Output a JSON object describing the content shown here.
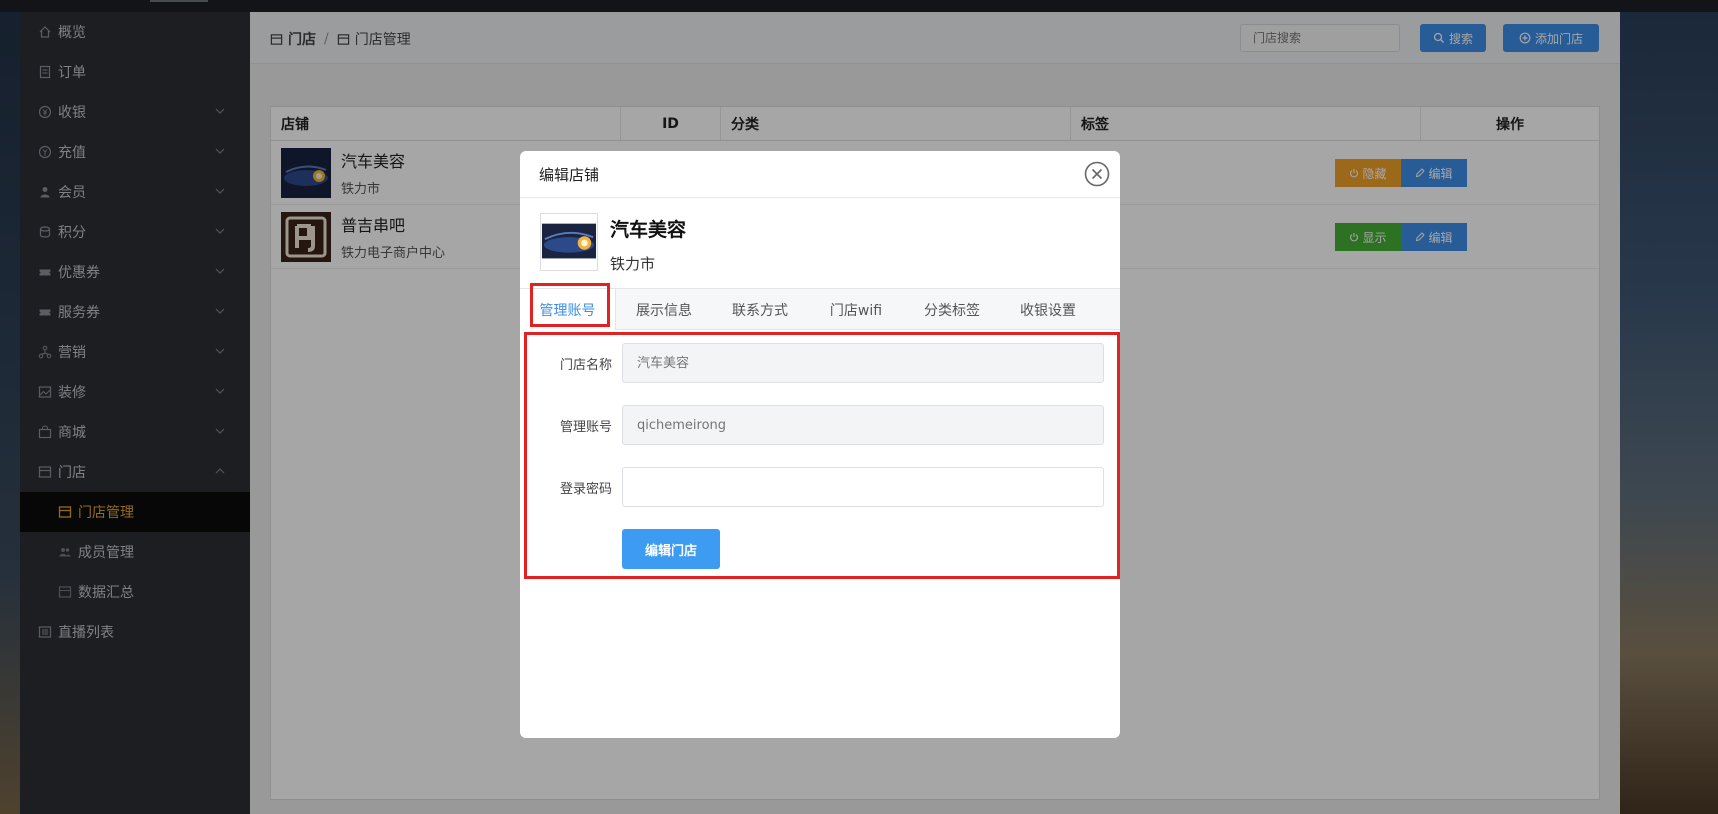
{
  "sidebar": {
    "items": [
      {
        "label": "概览",
        "icon": "home-icon"
      },
      {
        "label": "订单",
        "icon": "order-icon"
      },
      {
        "label": "收银",
        "icon": "cashier-icon"
      },
      {
        "label": "充值",
        "icon": "recharge-icon"
      },
      {
        "label": "会员",
        "icon": "member-icon"
      },
      {
        "label": "积分",
        "icon": "points-icon"
      },
      {
        "label": "优惠券",
        "icon": "coupon-icon"
      },
      {
        "label": "服务券",
        "icon": "service-ticket-icon"
      },
      {
        "label": "营销",
        "icon": "marketing-icon"
      },
      {
        "label": "装修",
        "icon": "decoration-icon"
      },
      {
        "label": "商城",
        "icon": "mall-icon"
      },
      {
        "label": "门店",
        "icon": "store-icon"
      },
      {
        "label": "门店管理",
        "icon": "store-icon"
      },
      {
        "label": "成员管理",
        "icon": "members-icon"
      },
      {
        "label": "数据汇总",
        "icon": "data-icon"
      },
      {
        "label": "直播列表",
        "icon": "live-list-icon"
      }
    ],
    "active_color": "#e3a52f"
  },
  "header": {
    "breadcrumb": [
      "门店",
      "门店管理"
    ],
    "search_placeholder": "门店搜索",
    "search_button": "搜索",
    "add_button": "添加门店"
  },
  "table": {
    "headers": [
      "店铺",
      "ID",
      "分类",
      "标签",
      "操作"
    ],
    "rows": [
      {
        "name": "汽车美容",
        "sub": "铁力市",
        "toggle": "隐藏",
        "edit": "编辑"
      },
      {
        "name": "普吉串吧",
        "sub": "铁力电子商户中心",
        "toggle": "显示",
        "edit": "编辑"
      }
    ]
  },
  "modal": {
    "title": "编辑店铺",
    "store_name": "汽车美容",
    "store_sub": "铁力市",
    "tabs": [
      "管理账号",
      "展示信息",
      "联系方式",
      "门店wifi",
      "分类标签",
      "收银设置"
    ],
    "form": {
      "name_label": "门店名称",
      "name_placeholder": "汽车美容",
      "account_label": "管理账号",
      "account_placeholder": "qichemeirong",
      "password_label": "登录密码",
      "password_value": "",
      "submit": "编辑门店"
    }
  },
  "colors": {
    "accent": "#3d8ee8",
    "hide": "#f0a028",
    "show": "#46b035",
    "highlight": "#e02222"
  }
}
